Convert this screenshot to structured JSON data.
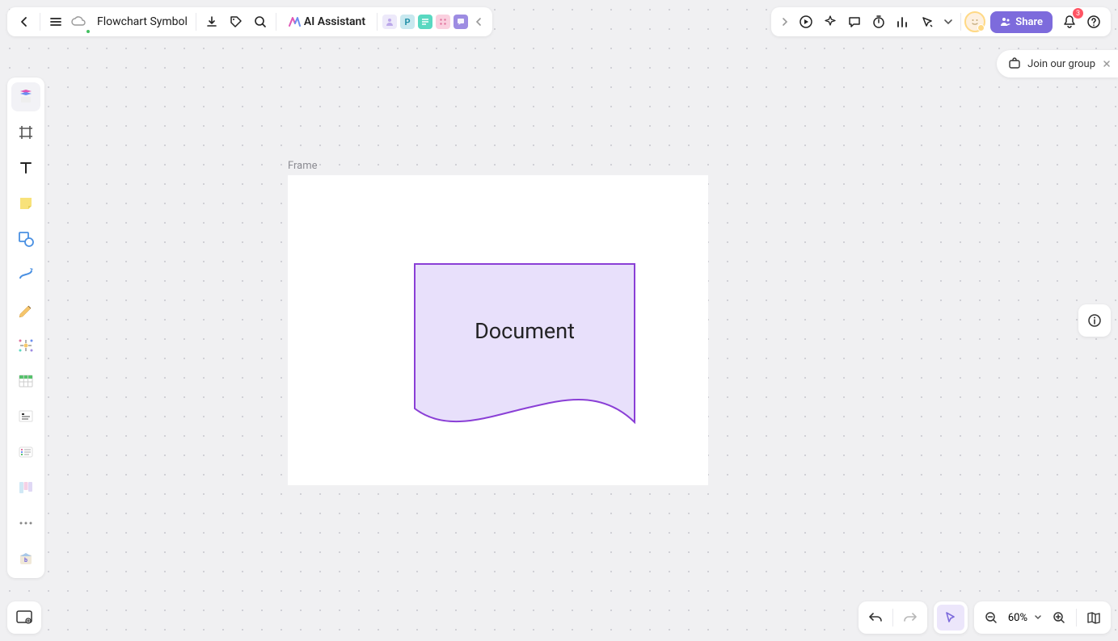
{
  "header": {
    "doc_title": "Flowchart Symbol",
    "ai_label": "AI Assistant",
    "share_label": "Share",
    "notification_count": "3",
    "badges": [
      "",
      "P",
      "",
      "",
      ""
    ]
  },
  "banner": {
    "join_label": "Join our group"
  },
  "canvas": {
    "frame_label": "Frame",
    "shape_text": "Document",
    "shape_stroke": "#8a3fd6",
    "shape_fill": "#e8e0fb"
  },
  "footer": {
    "zoom": "60%"
  }
}
